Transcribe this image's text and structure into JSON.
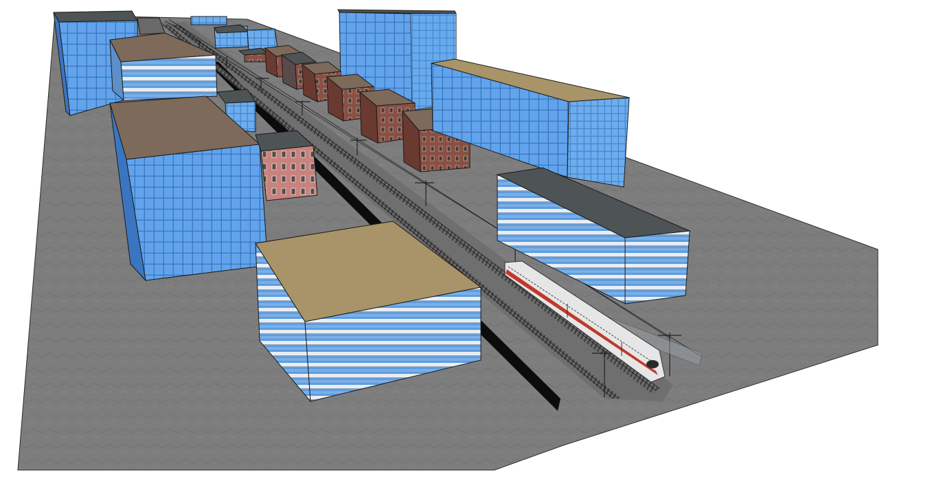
{
  "scene": {
    "kind": "3d-city-model-view",
    "ground_color": "#7d7d7d",
    "glass_color": "#4f95e0",
    "roof_tan_color": "#a89468",
    "roof_brown_color": "#7d6a5a",
    "roof_dark_color": "#4e5356",
    "brick_color": "#8a5044",
    "brick_pink_color": "#c8837e",
    "track_color": "#3a3a3a",
    "train_color": "#e6e6e6",
    "train_stripe_color": "#c0392b"
  },
  "objects": [
    {
      "name": "ground-plane",
      "material": "paving"
    },
    {
      "name": "rail-corridor",
      "material": "gravel-and-tracks"
    },
    {
      "name": "high-speed-train",
      "material": "white-with-red-stripe"
    },
    {
      "name": "glass-tower-left-far",
      "material": "blue-glass"
    },
    {
      "name": "glass-tower-left-mid",
      "material": "blue-glass"
    },
    {
      "name": "glass-highrise-center",
      "material": "blue-glass"
    },
    {
      "name": "glass-block-right",
      "material": "blue-glass"
    },
    {
      "name": "office-block-front",
      "material": "banded-glass"
    },
    {
      "name": "office-block-right",
      "material": "banded-glass"
    },
    {
      "name": "brick-row-buildings",
      "material": "brick"
    }
  ]
}
